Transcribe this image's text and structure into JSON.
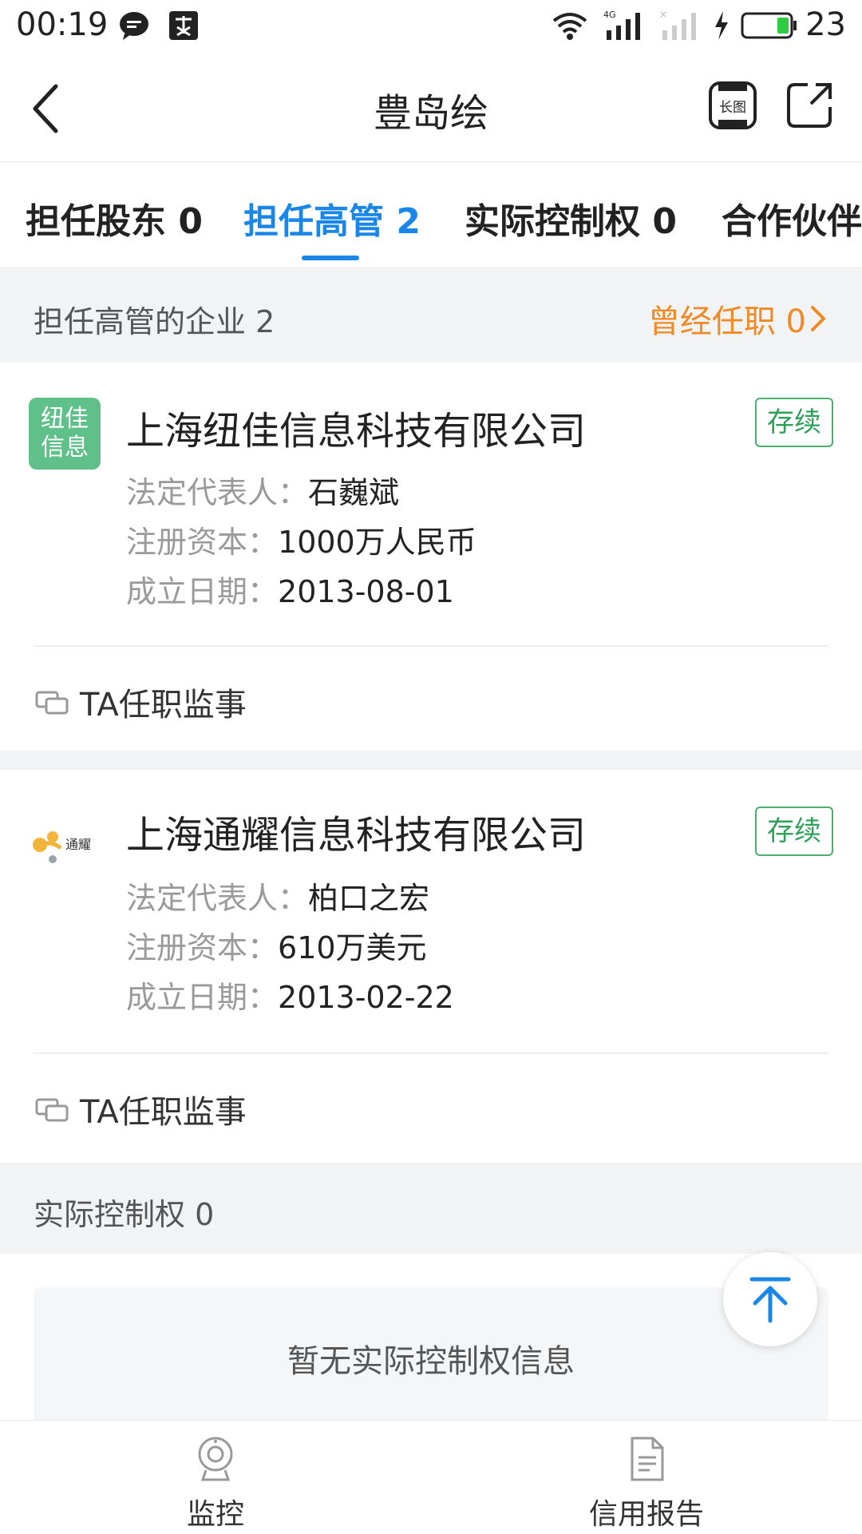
{
  "status_bar": {
    "time": "00:19",
    "battery": "23"
  },
  "header": {
    "title": "豊岛绘"
  },
  "tabs": [
    {
      "label": "担任股东 0"
    },
    {
      "label": "担任高管 2"
    },
    {
      "label": "实际控制权 0"
    },
    {
      "label": "合作伙伴"
    }
  ],
  "section_exec": {
    "title": "担任高管的企业 2",
    "history_link": "曾经任职 0"
  },
  "companies": [
    {
      "logo_text": "纽佳信息",
      "name": "上海纽佳信息科技有限公司",
      "status": "存续",
      "legal_rep_label": "法定代表人：",
      "legal_rep": "石巍斌",
      "capital_label": "注册资本：",
      "capital": "1000万人民币",
      "date_label": "成立日期：",
      "date": "2013-08-01",
      "role": "TA任职监事"
    },
    {
      "logo_text": "通耀",
      "name": "上海通耀信息科技有限公司",
      "status": "存续",
      "legal_rep_label": "法定代表人：",
      "legal_rep": "柏口之宏",
      "capital_label": "注册资本：",
      "capital": "610万美元",
      "date_label": "成立日期：",
      "date": "2013-02-22",
      "role": "TA任职监事"
    }
  ],
  "section_control": {
    "title": "实际控制权 0",
    "empty_text": "暂无实际控制权信息"
  },
  "bottom_bar": {
    "monitor": "监控",
    "report": "信用报告"
  },
  "colors": {
    "accent": "#1a87e8",
    "orange": "#f08a24",
    "green": "#2ea05a"
  }
}
